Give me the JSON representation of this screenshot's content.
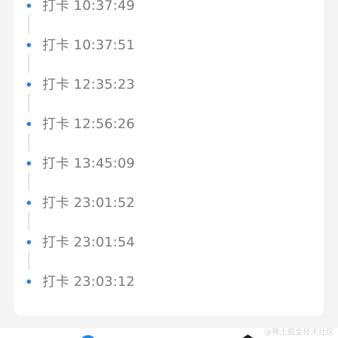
{
  "records": [
    {
      "action": "打卡",
      "time": "10:37:49"
    },
    {
      "action": "打卡",
      "time": "10:37:51"
    },
    {
      "action": "打卡",
      "time": "12:35:23"
    },
    {
      "action": "打卡",
      "time": "12:56:26"
    },
    {
      "action": "打卡",
      "time": "13:45:09"
    },
    {
      "action": "打卡",
      "time": "23:01:52"
    },
    {
      "action": "打卡",
      "time": "23:01:54"
    },
    {
      "action": "打卡",
      "time": "23:03:12"
    }
  ],
  "watermark": "@稀土掘金技术社区",
  "colors": {
    "accent": "#2c7ee0",
    "text": "#7a7a7a",
    "card": "#ffffff",
    "background": "#f4f4f4"
  },
  "icons": {
    "timeline_dot": "dot-icon",
    "bottom_left": "tab-icon",
    "bottom_right": "tab-icon"
  }
}
